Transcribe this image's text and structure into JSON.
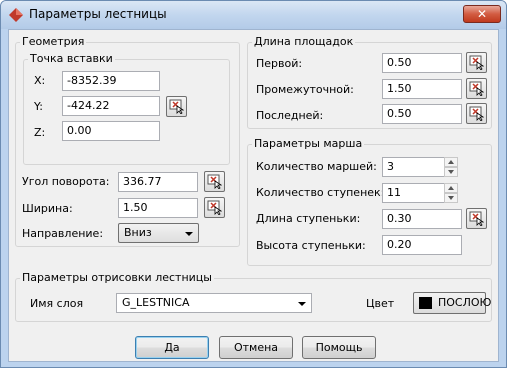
{
  "window": {
    "title": "Параметры лестницы"
  },
  "geometry": {
    "legend": "Геометрия",
    "insert_point": {
      "legend": "Точка вставки",
      "x_label": "X:",
      "x_value": "-8352.39",
      "y_label": "Y:",
      "y_value": "-424.22",
      "z_label": "Z:",
      "z_value": "0.00"
    },
    "rotation_label": "Угол поворота:",
    "rotation_value": "336.77",
    "width_label": "Ширина:",
    "width_value": "1.50",
    "direction_label": "Направление:",
    "direction_value": "Вниз"
  },
  "landing": {
    "legend": "Длина площадок",
    "first_label": "Первой:",
    "first_value": "0.50",
    "middle_label": "Промежуточной:",
    "middle_value": "1.50",
    "last_label": "Последней:",
    "last_value": "0.50"
  },
  "flight": {
    "legend": "Параметры марша",
    "count_label": "Количество маршей:",
    "count_value": "3",
    "steps_label": "Количество ступенек:",
    "steps_value": "11",
    "step_length_label": "Длина ступеньки:",
    "step_length_value": "0.30",
    "step_height_label": "Высота ступеньки:",
    "step_height_value": "0.20"
  },
  "render": {
    "legend": "Параметры отрисовки лестницы",
    "layer_label": "Имя слоя",
    "layer_value": "G_LESTNICA",
    "color_label": "Цвет",
    "color_value": "ПОСЛОЮ",
    "swatch_color": "#000000"
  },
  "buttons": {
    "ok": "Да",
    "cancel": "Отмена",
    "help": "Помощь"
  },
  "colors": {
    "title_bar": "#c2d6ee",
    "close_button": "#c8452a",
    "default_button_border": "#3c7fb1"
  }
}
